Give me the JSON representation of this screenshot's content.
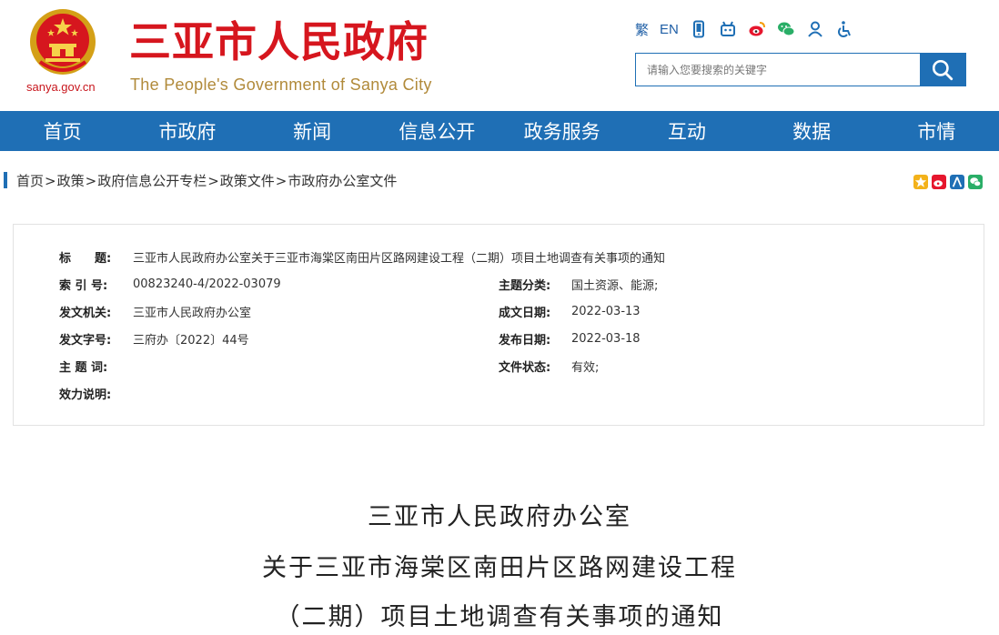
{
  "header": {
    "site_domain": "sanya.gov.cn",
    "title_cn": "三亚市人民政府",
    "title_en": "The People's Government of Sanya City",
    "util": {
      "traditional": "繁",
      "english": "EN"
    },
    "search": {
      "placeholder": "请输入您要搜索的关键字",
      "value": ""
    }
  },
  "nav": {
    "items": [
      "首页",
      "市政府",
      "新闻",
      "信息公开",
      "政务服务",
      "互动",
      "数据",
      "市情"
    ]
  },
  "breadcrumb": {
    "items": [
      "首页",
      "政策",
      "政府信息公开专栏",
      "政策文件",
      "市政府办公室文件"
    ],
    "separator": ">"
  },
  "meta": {
    "title_label": "标　　题:",
    "title_value": "三亚市人民政府办公室关于三亚市海棠区南田片区路网建设工程（二期）项目土地调查有关事项的通知",
    "index_label": "索 引 号:",
    "index_value": "00823240-4/2022-03079",
    "topic_label": "主题分类:",
    "topic_value": "国土资源、能源;",
    "issuer_label": "发文机关:",
    "issuer_value": "三亚市人民政府办公室",
    "created_label": "成文日期:",
    "created_value": "2022-03-13",
    "docno_label": "发文字号:",
    "docno_value": "三府办〔2022〕44号",
    "published_label": "发布日期:",
    "published_value": "2022-03-18",
    "keywords_label": "主 题 词:",
    "keywords_value": "",
    "status_label": "文件状态:",
    "status_value": "有效;",
    "validity_label": "效力说明:",
    "validity_value": ""
  },
  "document": {
    "title_line1": "三亚市人民政府办公室",
    "title_line2": "关于三亚市海棠区南田片区路网建设工程",
    "title_line3": "（二期）项目土地调查有关事项的通知"
  },
  "colors": {
    "brand_red": "#d6161e",
    "brand_blue": "#1f6fb5",
    "gold": "#b18a3a"
  }
}
